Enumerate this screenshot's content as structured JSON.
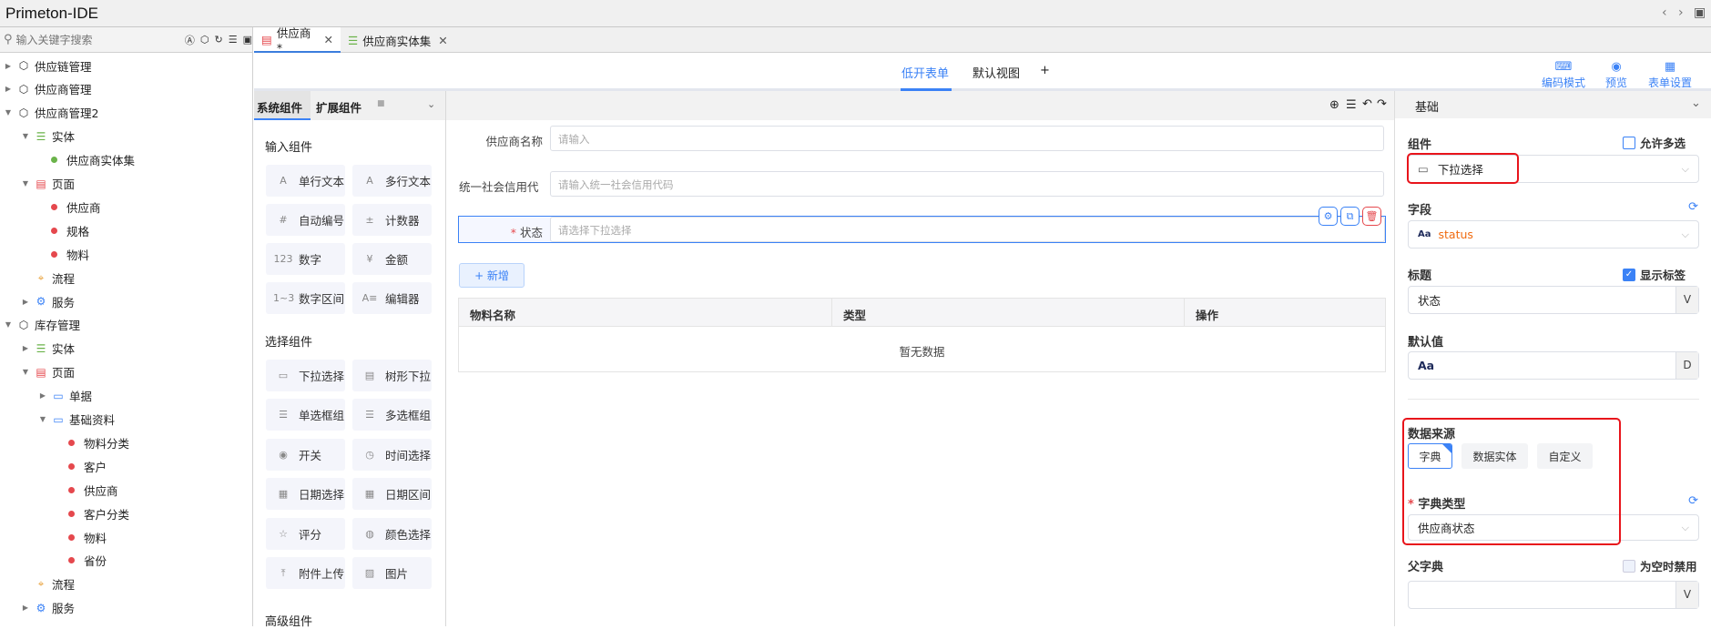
{
  "app": {
    "title": "Primeton-IDE"
  },
  "search": {
    "placeholder": "输入关键字搜索"
  },
  "tree": [
    {
      "label": "供应链管理",
      "level": 0,
      "caret": "▶",
      "icon": "package-icon"
    },
    {
      "label": "供应商管理",
      "level": 0,
      "caret": "▶",
      "icon": "package-icon"
    },
    {
      "label": "供应商管理2",
      "level": 0,
      "caret": "▼",
      "icon": "package-icon"
    },
    {
      "label": "实体",
      "level": 1,
      "caret": "▼",
      "icon": "database-icon"
    },
    {
      "label": "供应商实体集",
      "level": 2,
      "caret": "",
      "icon": "dot-green"
    },
    {
      "label": "页面",
      "level": 1,
      "caret": "▼",
      "icon": "page-icon"
    },
    {
      "label": "供应商",
      "level": 2,
      "caret": "",
      "icon": "dot-red"
    },
    {
      "label": "规格",
      "level": 2,
      "caret": "",
      "icon": "dot-red"
    },
    {
      "label": "物料",
      "level": 2,
      "caret": "",
      "icon": "dot-red"
    },
    {
      "label": "流程",
      "level": 1,
      "caret": "",
      "icon": "flow-icon"
    },
    {
      "label": "服务",
      "level": 1,
      "caret": "▶",
      "icon": "gear-icon"
    },
    {
      "label": "库存管理",
      "level": 0,
      "caret": "▼",
      "icon": "package-icon"
    },
    {
      "label": "实体",
      "level": 1,
      "caret": "▶",
      "icon": "database-icon"
    },
    {
      "label": "页面",
      "level": 1,
      "caret": "▼",
      "icon": "page-icon"
    },
    {
      "label": "单据",
      "level": 2,
      "caret": "▶",
      "icon": "folder-icon"
    },
    {
      "label": "基础资料",
      "level": 2,
      "caret": "▼",
      "icon": "folder-icon"
    },
    {
      "label": "物料分类",
      "level": 3,
      "caret": "",
      "icon": "dot-red"
    },
    {
      "label": "客户",
      "level": 3,
      "caret": "",
      "icon": "dot-red"
    },
    {
      "label": "供应商",
      "level": 3,
      "caret": "",
      "icon": "dot-red"
    },
    {
      "label": "客户分类",
      "level": 3,
      "caret": "",
      "icon": "dot-red"
    },
    {
      "label": "物料",
      "level": 3,
      "caret": "",
      "icon": "dot-red"
    },
    {
      "label": "省份",
      "level": 3,
      "caret": "",
      "icon": "dot-red"
    },
    {
      "label": "流程",
      "level": 1,
      "caret": "",
      "icon": "flow-icon"
    },
    {
      "label": "服务",
      "level": 1,
      "caret": "▶",
      "icon": "gear-icon"
    }
  ],
  "tabs": [
    {
      "label": "供应商*"
    },
    {
      "label": "供应商实体集"
    }
  ],
  "form_tabs": {
    "active": "低开表单",
    "other": "默认视图",
    "add": "+"
  },
  "top_actions": {
    "code": "编码模式",
    "preview": "预览",
    "settings": "表单设置"
  },
  "components": {
    "tab_system": "系统组件",
    "tab_ext": "扩展组件",
    "input_title": "输入组件",
    "input": [
      {
        "label": "单行文本",
        "icon": "A"
      },
      {
        "label": "多行文本",
        "icon": "A"
      },
      {
        "label": "自动编号",
        "icon": "#"
      },
      {
        "label": "计数器",
        "icon": "±"
      },
      {
        "label": "数字",
        "icon": "123"
      },
      {
        "label": "金额",
        "icon": "¥"
      },
      {
        "label": "数字区间",
        "icon": "1~3"
      },
      {
        "label": "编辑器",
        "icon": "A≡"
      }
    ],
    "select_title": "选择组件",
    "select": [
      {
        "label": "下拉选择",
        "icon": "▭"
      },
      {
        "label": "树形下拉",
        "icon": "▤"
      },
      {
        "label": "单选框组",
        "icon": "☰"
      },
      {
        "label": "多选框组",
        "icon": "☰"
      },
      {
        "label": "开关",
        "icon": "◉"
      },
      {
        "label": "时间选择",
        "icon": "◷"
      },
      {
        "label": "日期选择",
        "icon": "▦"
      },
      {
        "label": "日期区间",
        "icon": "▦"
      },
      {
        "label": "评分",
        "icon": "☆"
      },
      {
        "label": "颜色选择",
        "icon": "◍"
      },
      {
        "label": "附件上传",
        "icon": "⤒"
      },
      {
        "label": "图片",
        "icon": "▨"
      }
    ],
    "advanced_title": "高级组件"
  },
  "form": {
    "fields": [
      {
        "label": "供应商名称",
        "placeholder": "请输入"
      },
      {
        "label": "统一社会信用代",
        "placeholder": "请输入统一社会信用代码"
      },
      {
        "label": "状态",
        "required": "*",
        "placeholder": "请选择下拉选择"
      }
    ],
    "add_button": "+ 新增",
    "table": {
      "columns": [
        "物料名称",
        "类型",
        "操作"
      ],
      "empty": "暂无数据"
    }
  },
  "props": {
    "section": "基础",
    "component_label": "组件",
    "allow_multi": "允许多选",
    "component_value": "下拉选择",
    "field_label": "字段",
    "field_prefix": "Aa",
    "field_value": "status",
    "title_label": "标题",
    "show_label": "显示标签",
    "title_value": "状态",
    "title_addon": "V",
    "default_label": "默认值",
    "default_prefix": "Aa",
    "default_addon": "D",
    "source_label": "数据来源",
    "sources": [
      "字典",
      "数据实体",
      "自定义"
    ],
    "dict_type_label": "字典类型",
    "dict_type_value": "供应商状态",
    "parent_dict_label": "父字典",
    "disable_empty": "为空时禁用",
    "parent_addon": "V"
  },
  "colors": {
    "accent": "#3b82f6",
    "highlight": "#e8141b",
    "required": "#e5484d"
  }
}
